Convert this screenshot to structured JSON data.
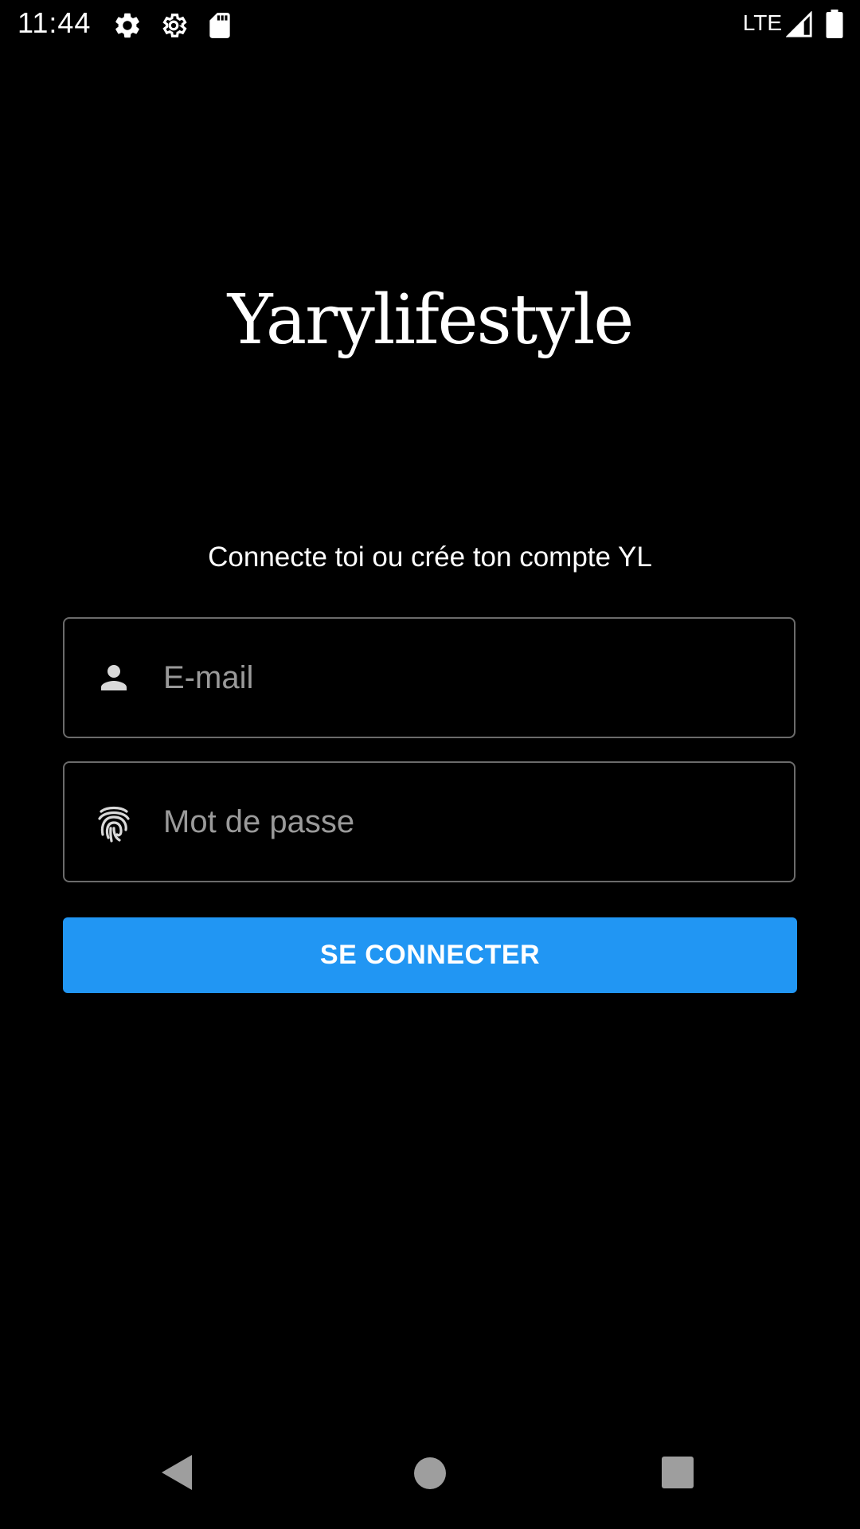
{
  "status_bar": {
    "time": "11:44",
    "network": "LTE",
    "icons": [
      "settings-icon",
      "settings-outline-icon",
      "sd-card-icon",
      "signal-icon",
      "battery-icon"
    ]
  },
  "app": {
    "logo_text": "Yarylifestyle",
    "subtitle": "Connecte toi ou crée ton compte YL"
  },
  "form": {
    "email": {
      "placeholder": "E-mail",
      "value": "",
      "icon": "person-icon"
    },
    "password": {
      "placeholder": "Mot de passe",
      "value": "",
      "icon": "fingerprint-icon"
    },
    "submit_label": "SE CONNECTER"
  },
  "nav_bar": {
    "buttons": [
      "back",
      "home",
      "recents"
    ]
  },
  "colors": {
    "background": "#000000",
    "accent": "#2196f3",
    "field_border": "#6b6b6b",
    "placeholder": "#9a9a9a",
    "nav_icons": "#9e9e9e"
  }
}
